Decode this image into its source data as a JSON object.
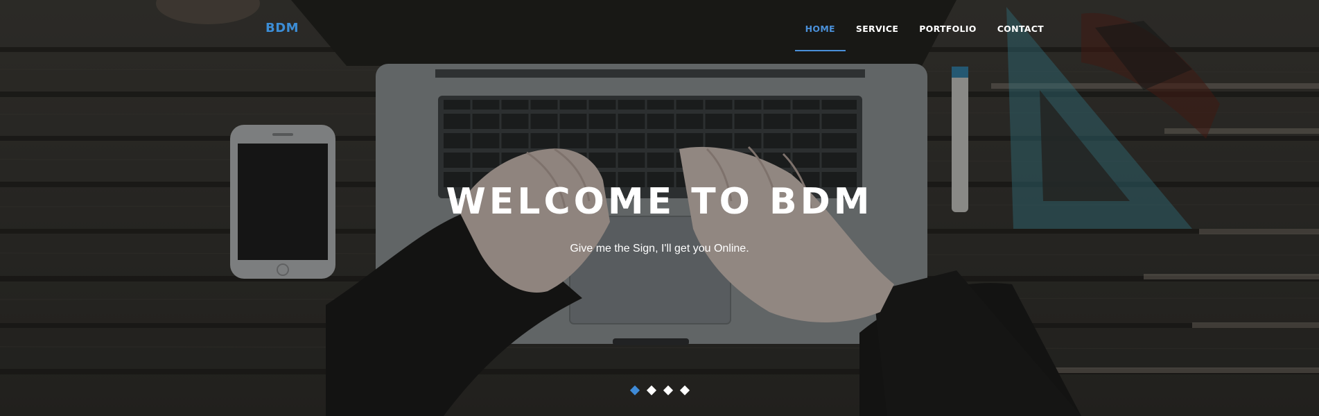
{
  "brand": {
    "label": "BDM",
    "color": "#3c8dd6"
  },
  "nav": {
    "items": [
      {
        "label": "HOME",
        "active": true
      },
      {
        "label": "SERVICE",
        "active": false
      },
      {
        "label": "PORTFOLIO",
        "active": false
      },
      {
        "label": "CONTACT",
        "active": false
      }
    ],
    "active_color": "#4a90d9"
  },
  "hero": {
    "title": "WELCOME TO BDM",
    "subtitle": "Give me the Sign, I'll get you Online."
  },
  "carousel": {
    "slide_count": 4,
    "active_index": 0,
    "active_color": "#3f8bd8"
  }
}
